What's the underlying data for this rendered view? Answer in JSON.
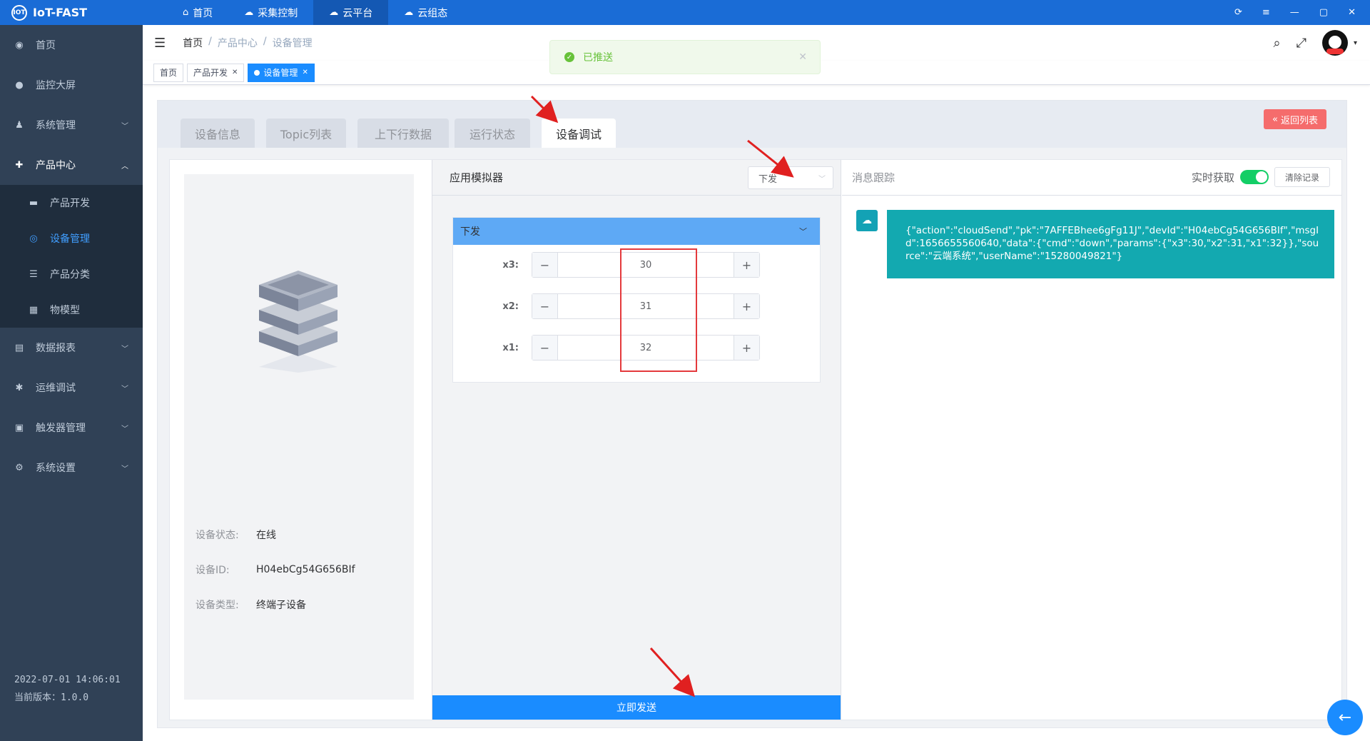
{
  "app": {
    "name": "IoT-FAST",
    "logo_text": "IOT"
  },
  "topnav": [
    {
      "label": "首页",
      "icon": "home-icon"
    },
    {
      "label": "采集控制",
      "icon": "cloud-icon"
    },
    {
      "label": "云平台",
      "icon": "cloud-platform-icon"
    },
    {
      "label": "云组态",
      "icon": "cloud-config-icon"
    }
  ],
  "sidebar": {
    "items": [
      {
        "label": "首页"
      },
      {
        "label": "监控大屏"
      },
      {
        "label": "系统管理"
      },
      {
        "label": "产品中心"
      },
      {
        "label": "产品开发"
      },
      {
        "label": "设备管理"
      },
      {
        "label": "产品分类"
      },
      {
        "label": "物模型"
      },
      {
        "label": "数据报表"
      },
      {
        "label": "运维调试"
      },
      {
        "label": "触发器管理"
      },
      {
        "label": "系统设置"
      }
    ],
    "datetime": "2022-07-01 14:06:01",
    "version": "当前版本：1.0.0"
  },
  "breadcrumb": {
    "home": "首页",
    "level2": "产品中心",
    "level3": "设备管理",
    "sep": "/"
  },
  "toast": {
    "message": "已推送"
  },
  "tagsview": [
    {
      "label": "首页"
    },
    {
      "label": "产品开发"
    },
    {
      "label": "设备管理"
    }
  ],
  "tabs": [
    {
      "label": "设备信息"
    },
    {
      "label": "Topic列表"
    },
    {
      "label": "上下行数据"
    },
    {
      "label": "运行状态"
    },
    {
      "label": "设备调试"
    }
  ],
  "back_button": "返回列表",
  "device": {
    "status_label": "设备状态:",
    "status_value": "在线",
    "id_label": "设备ID:",
    "id_value": "H04ebCg54G656BIf",
    "type_label": "设备类型:",
    "type_value": "终端子设备"
  },
  "simulator": {
    "title": "应用模拟器",
    "select_value": "下发",
    "form_title": "下发",
    "params": [
      {
        "label": "x3:",
        "value": "30"
      },
      {
        "label": "x2:",
        "value": "31"
      },
      {
        "label": "x1:",
        "value": "32"
      }
    ],
    "send_label": "立即发送"
  },
  "trace": {
    "title": "消息跟踪",
    "realtime_label": "实时获取",
    "realtime_on": true,
    "clear_label": "清除记录",
    "message": "{\"action\":\"cloudSend\",\"pk\":\"7AFFEBhee6gFg11J\",\"devId\":\"H04ebCg54G656BIf\",\"msgId\":1656655560640,\"data\":{\"cmd\":\"down\",\"params\":{\"x3\":30,\"x2\":31,\"x1\":32}},\"source\":\"云端系统\",\"userName\":\"15280049821\"}"
  },
  "colors": {
    "topbar": "#1a6cd6",
    "sidebar": "#304156",
    "accent": "#1a8cff",
    "message_bg": "#13a9b0",
    "danger": "#f56c6c",
    "success": "#67c23a"
  }
}
